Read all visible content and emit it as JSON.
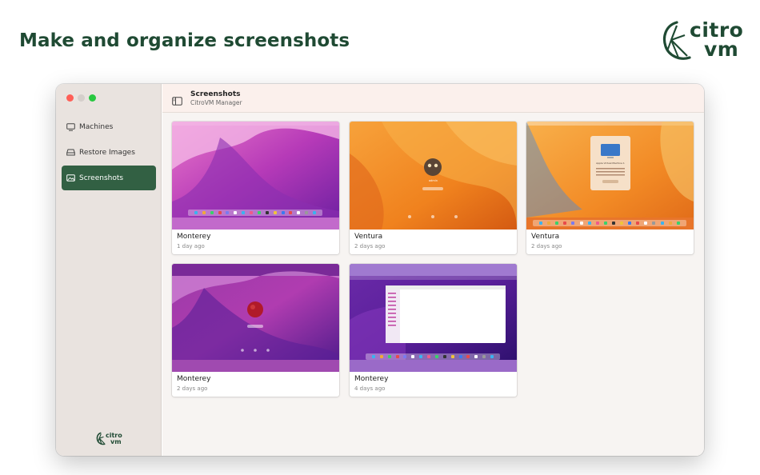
{
  "headline": "Make and organize screenshots",
  "brand": {
    "line1": "citro",
    "line2": "vm",
    "color": "#1f4a33"
  },
  "sidebar": {
    "items": [
      {
        "label": "Machines",
        "icon": "monitor-icon",
        "active": false
      },
      {
        "label": "Restore Images",
        "icon": "drive-icon",
        "active": false
      },
      {
        "label": "Screenshots",
        "icon": "photo-icon",
        "active": true
      }
    ],
    "logo_line1": "citro",
    "logo_line2": "vm",
    "active_color": "#326043"
  },
  "toolbar": {
    "title": "Screenshots",
    "subtitle": "CitroVM Manager",
    "sidebar_toggle_icon": "sidebar-toggle-icon"
  },
  "screenshots": [
    {
      "name": "Monterey",
      "age": "1 day ago",
      "theme": "monterey-desktop"
    },
    {
      "name": "Ventura",
      "age": "2 days ago",
      "theme": "ventura-login"
    },
    {
      "name": "Ventura",
      "age": "2 days ago",
      "theme": "ventura-about"
    },
    {
      "name": "Monterey",
      "age": "2 days ago",
      "theme": "monterey-login"
    },
    {
      "name": "Monterey",
      "age": "4 days ago",
      "theme": "monterey-finder"
    }
  ],
  "thumbnail_texts": {
    "login_user": "admin",
    "about_title": "Apple Virtual Machine 1"
  }
}
